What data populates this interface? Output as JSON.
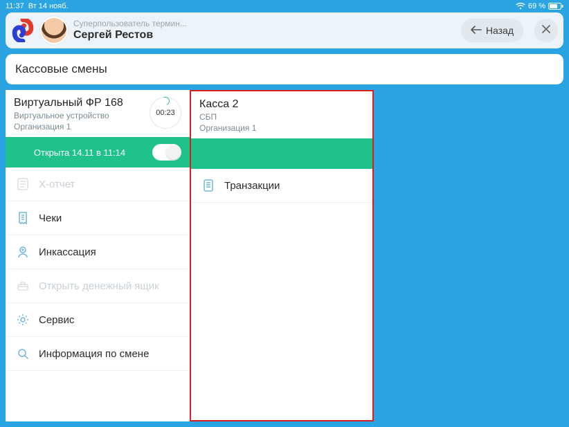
{
  "status": {
    "time": "11:37",
    "date": "Вт 14 нояб.",
    "battery": "69 %"
  },
  "header": {
    "role": "Суперпользователь термин...",
    "user_name": "Сергей Рестов",
    "back_label": "Назад"
  },
  "page_title": "Кассовые смены",
  "left": {
    "title": "Виртуальный ФР 168",
    "sub1": "Виртуальное устройство",
    "sub2": "Организация 1",
    "timer": "00:23",
    "status_text": "Открыта 14.11 в 11:14",
    "menu": {
      "xreport": "Х-отчет",
      "cheki": "Чеки",
      "inkass": "Инкассация",
      "open_drawer": "Открыть денежный ящик",
      "service": "Сервис",
      "shift_info": "Информация по смене"
    }
  },
  "right": {
    "title": "Касса 2",
    "sub1": "СБП",
    "sub2": "Организация 1",
    "menu": {
      "transactions": "Транзакции"
    }
  }
}
